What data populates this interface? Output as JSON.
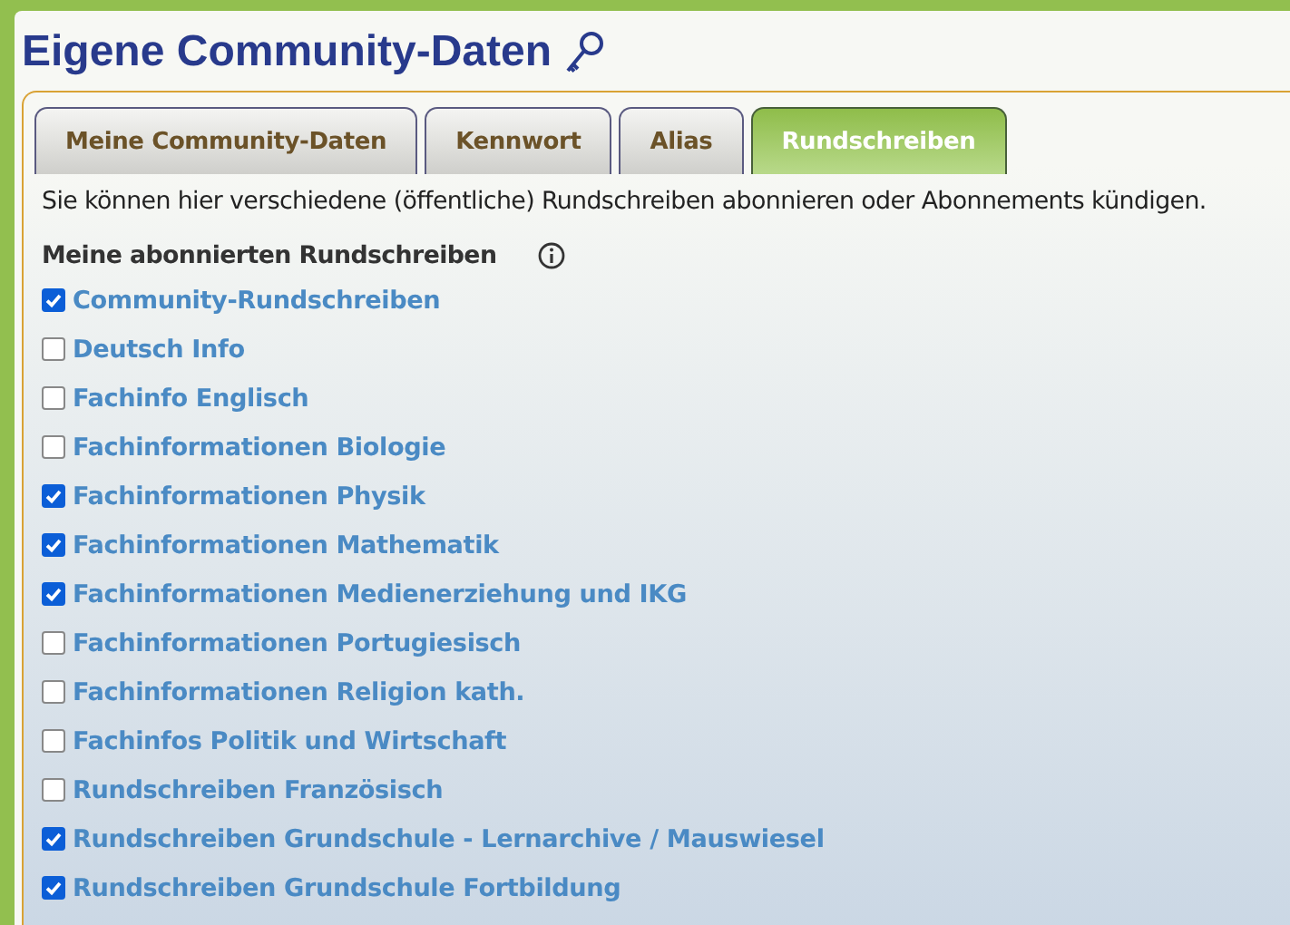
{
  "title": "Eigene Community-Daten",
  "tabs": [
    {
      "label": "Meine Community-Daten",
      "selected": false
    },
    {
      "label": "Kennwort",
      "selected": false
    },
    {
      "label": "Alias",
      "selected": false
    },
    {
      "label": "Rundschreiben",
      "selected": true
    }
  ],
  "intro": "Sie können hier verschiedene (öffentliche) Rundschreiben abonnieren oder Abonnements kündigen.",
  "section_heading": "Meine abonnierten Rundschreiben",
  "newsletters": [
    {
      "label": "Community-Rundschreiben",
      "checked": true
    },
    {
      "label": "Deutsch Info",
      "checked": false
    },
    {
      "label": "Fachinfo Englisch",
      "checked": false
    },
    {
      "label": "Fachinformationen Biologie",
      "checked": false
    },
    {
      "label": "Fachinformationen Physik",
      "checked": true
    },
    {
      "label": "Fachinformationen Mathematik",
      "checked": true
    },
    {
      "label": "Fachinformationen Medienerziehung und IKG",
      "checked": true
    },
    {
      "label": "Fachinformationen Portugiesisch",
      "checked": false
    },
    {
      "label": "Fachinformationen Religion kath.",
      "checked": false
    },
    {
      "label": "Fachinfos Politik und Wirtschaft",
      "checked": false
    },
    {
      "label": "Rundschreiben Französisch",
      "checked": false
    },
    {
      "label": "Rundschreiben Grundschule - Lernarchive / Mauswiesel",
      "checked": true
    },
    {
      "label": "Rundschreiben Grundschule Fortbildung",
      "checked": true
    }
  ]
}
